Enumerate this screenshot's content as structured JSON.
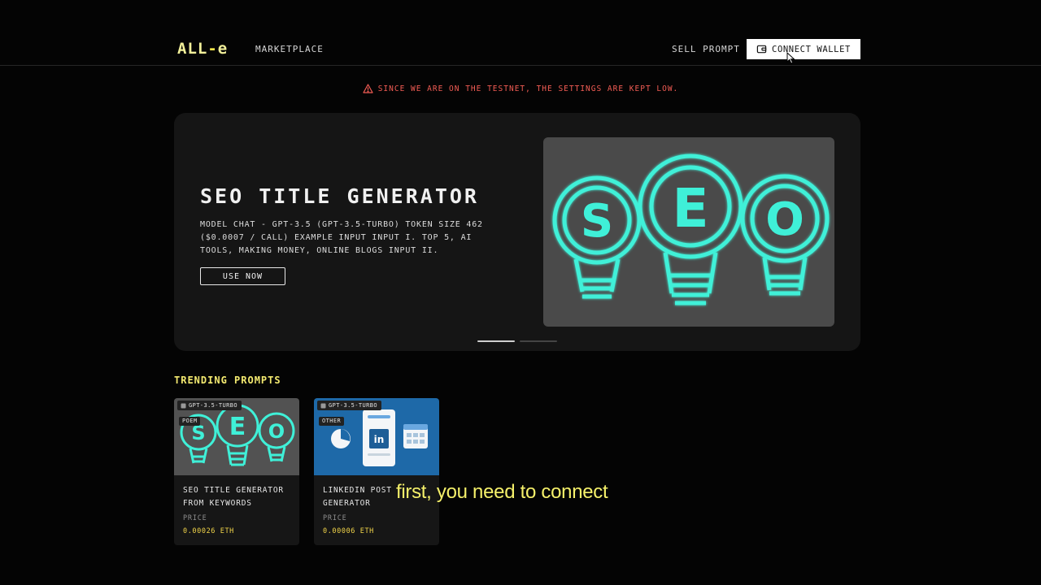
{
  "nav": {
    "logo_main": "ALL",
    "logo_dash": "-",
    "logo_tail": "e",
    "marketplace": "MARKETPLACE",
    "sell_prompt": "SELL PROMPT",
    "connect_wallet": "CONNECT WALLET"
  },
  "warning": "SINCE WE ARE ON THE TESTNET, THE SETTINGS ARE KEPT LOW.",
  "hero": {
    "title": "SEO TITLE GENERATOR",
    "description": "MODEL CHAT - GPT-3.5 (GPT-3.5-TURBO) TOKEN SIZE 462 ($0.0007 / CALL) EXAMPLE INPUT INPUT I. TOP 5, AI TOOLS, MAKING MONEY, ONLINE BLOGS INPUT II.",
    "button": "USE NOW",
    "image_letters": [
      "S",
      "E",
      "O"
    ]
  },
  "trending": {
    "title": "TRENDING PROMPTS",
    "cards": [
      {
        "model": "GPT-3.5-TURBO",
        "category": "POEM",
        "title": "SEO TITLE GENERATOR FROM KEYWORDS",
        "price_label": "PRICE",
        "price": "0.00026 ETH",
        "image_letters": [
          "S",
          "E",
          "O"
        ]
      },
      {
        "model": "GPT-3.5-TURBO",
        "category": "OTHER",
        "title": "LINKEDIN POST GENERATOR",
        "price_label": "PRICE",
        "price": "0.00006 ETH",
        "image_badge": "in"
      }
    ]
  },
  "caption": "first, you need to connect",
  "colors": {
    "logo": "#f2f09a",
    "warning": "#f25c54",
    "section_title": "#f4ea70",
    "price": "#f2d54a",
    "neon": "#3ff0d8",
    "caption": "#f5f06a"
  }
}
